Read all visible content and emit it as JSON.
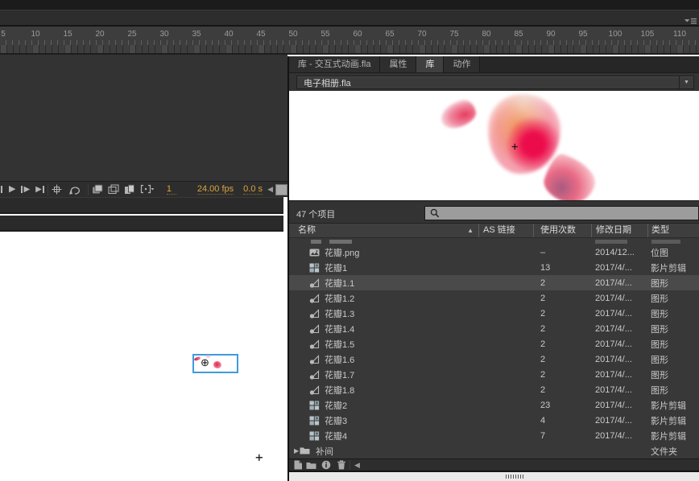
{
  "colors": {
    "accent_orange": "#dca53e",
    "selection_blue": "#3f9bdc",
    "panel_bg": "#383838",
    "dark_bar": "#2d2d2d",
    "preview_bg": "#ffffff"
  },
  "timeline": {
    "ruler_numbers": [
      5,
      10,
      15,
      20,
      25,
      30,
      35,
      40,
      45,
      50,
      55,
      60,
      65,
      70,
      75,
      80,
      85,
      90,
      95,
      100,
      105,
      110
    ],
    "controls": {
      "current_frame": "1",
      "frame_rate": "24.00 fps",
      "elapsed_time": "0.0 s"
    }
  },
  "library_panel": {
    "tabs": [
      {
        "label": "库 - 交互式动画.fla",
        "active": false
      },
      {
        "label": "属性",
        "active": false
      },
      {
        "label": "库",
        "active": true
      },
      {
        "label": "动作",
        "active": false
      }
    ],
    "document_select_value": "电子相册.fla",
    "items_count_label": "47 个项目",
    "search_value": "",
    "columns": [
      "名称",
      "AS 链接",
      "使用次数",
      "修改日期",
      "类型"
    ],
    "items": [
      {
        "name": "花瓣.png",
        "icon": "bitmap",
        "use_count": "–",
        "date": "2014/12...",
        "type": "位图",
        "selected": false
      },
      {
        "name": "花瓣1",
        "icon": "movieclip",
        "use_count": "13",
        "date": "2017/4/...",
        "type": "影片剪辑",
        "selected": false
      },
      {
        "name": "花瓣1.1",
        "icon": "graphic",
        "use_count": "2",
        "date": "2017/4/...",
        "type": "图形",
        "selected": true
      },
      {
        "name": "花瓣1.2",
        "icon": "graphic",
        "use_count": "2",
        "date": "2017/4/...",
        "type": "图形",
        "selected": false
      },
      {
        "name": "花瓣1.3",
        "icon": "graphic",
        "use_count": "2",
        "date": "2017/4/...",
        "type": "图形",
        "selected": false
      },
      {
        "name": "花瓣1.4",
        "icon": "graphic",
        "use_count": "2",
        "date": "2017/4/...",
        "type": "图形",
        "selected": false
      },
      {
        "name": "花瓣1.5",
        "icon": "graphic",
        "use_count": "2",
        "date": "2017/4/...",
        "type": "图形",
        "selected": false
      },
      {
        "name": "花瓣1.6",
        "icon": "graphic",
        "use_count": "2",
        "date": "2017/4/...",
        "type": "图形",
        "selected": false
      },
      {
        "name": "花瓣1.7",
        "icon": "graphic",
        "use_count": "2",
        "date": "2017/4/...",
        "type": "图形",
        "selected": false
      },
      {
        "name": "花瓣1.8",
        "icon": "graphic",
        "use_count": "2",
        "date": "2017/4/...",
        "type": "图形",
        "selected": false
      },
      {
        "name": "花瓣2",
        "icon": "movieclip",
        "use_count": "23",
        "date": "2017/4/...",
        "type": "影片剪辑",
        "selected": false
      },
      {
        "name": "花瓣3",
        "icon": "movieclip",
        "use_count": "4",
        "date": "2017/4/...",
        "type": "影片剪辑",
        "selected": false
      },
      {
        "name": "花瓣4",
        "icon": "movieclip",
        "use_count": "7",
        "date": "2017/4/...",
        "type": "影片剪辑",
        "selected": false
      },
      {
        "name": "补间",
        "icon": "folder",
        "use_count": "",
        "date": "",
        "type": "文件夹",
        "selected": false
      }
    ]
  }
}
